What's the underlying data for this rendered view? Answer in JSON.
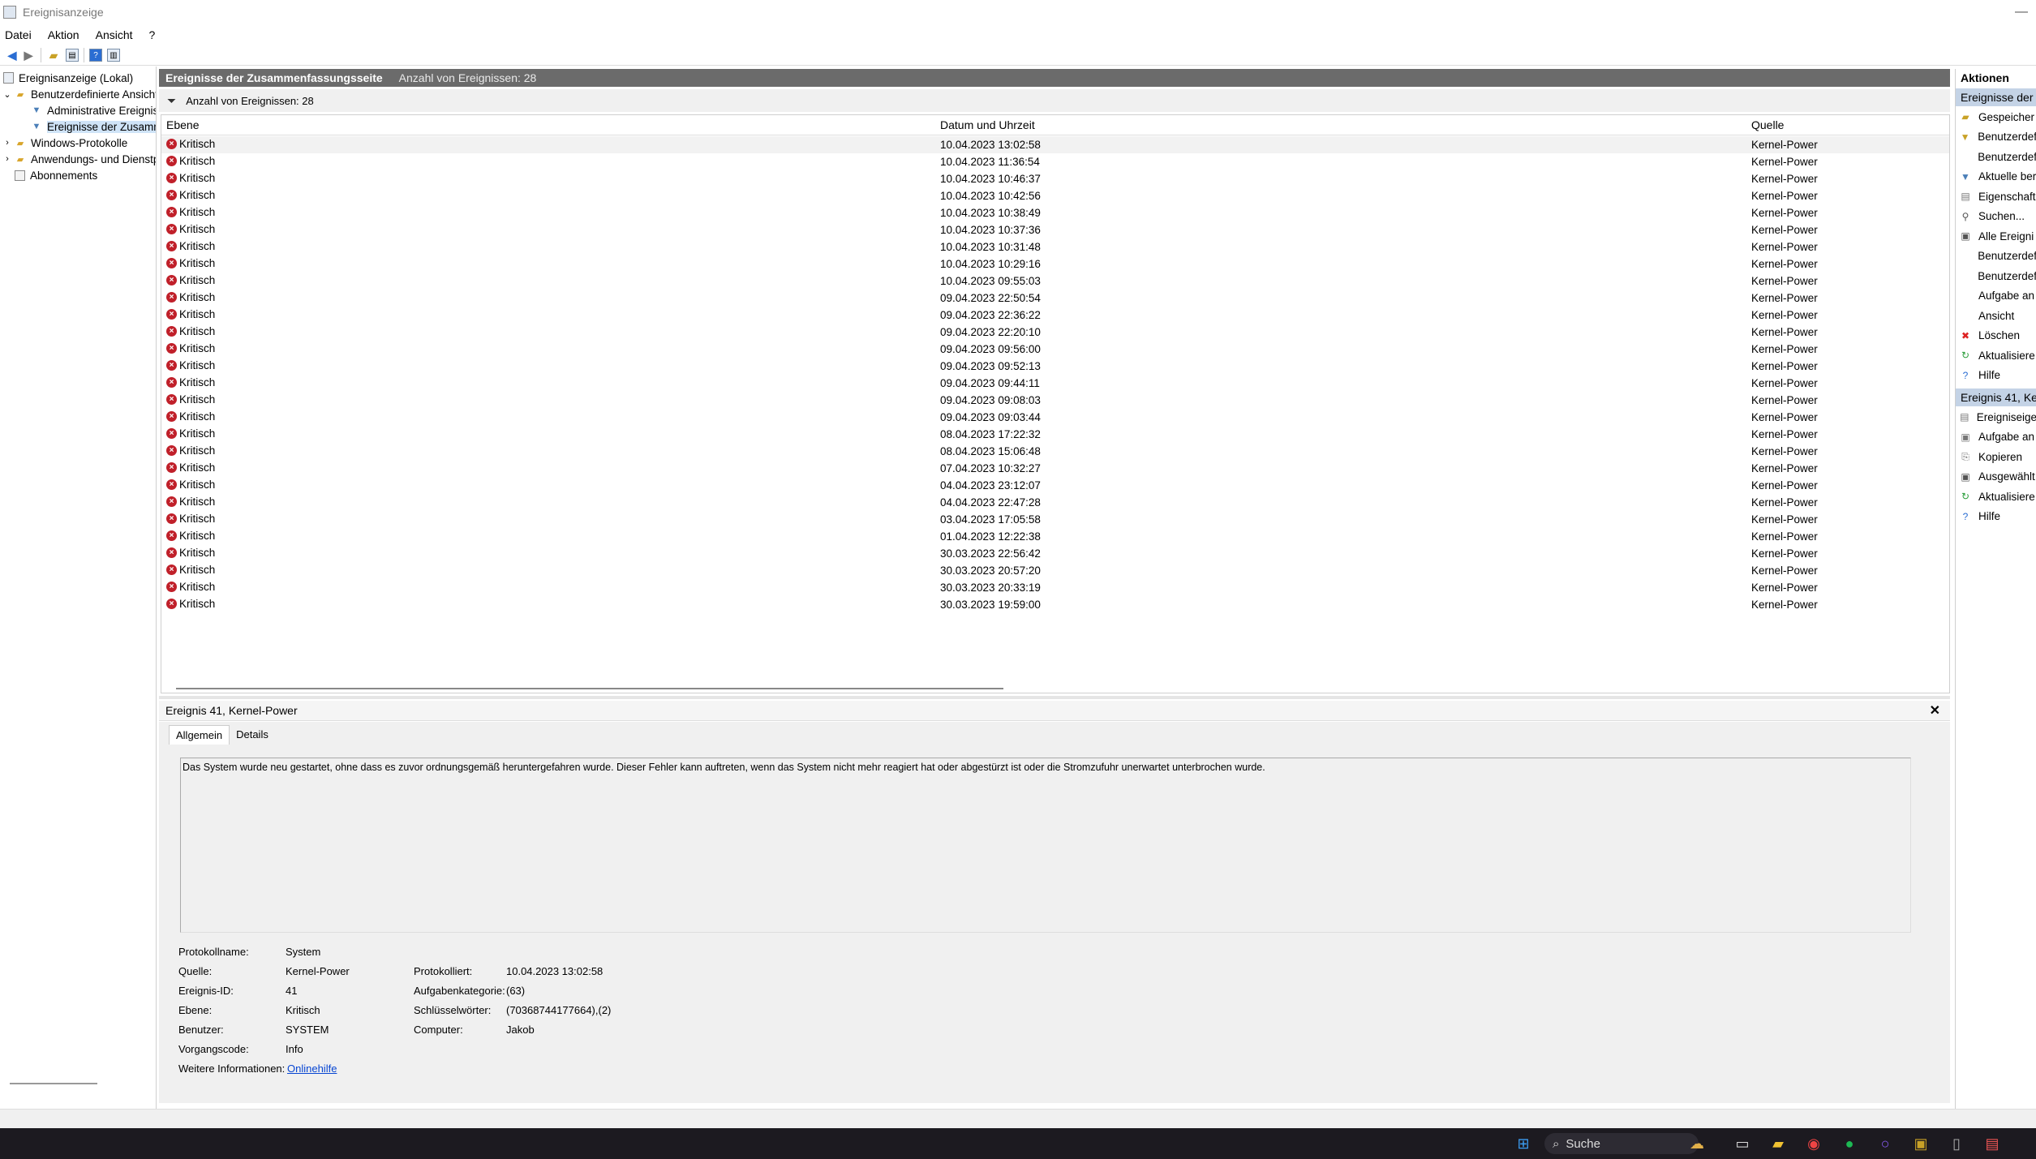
{
  "window": {
    "title": "Ereignisanzeige",
    "minimize_glyph": "—"
  },
  "menu": [
    "Datei",
    "Aktion",
    "Ansicht",
    "?"
  ],
  "toolbar_icons": [
    "back-arrow-icon",
    "forward-arrow-icon",
    "folder-up-icon",
    "console-tree-icon",
    "help-icon",
    "show-hide-action-pane-icon"
  ],
  "tree": {
    "root": "Ereignisanzeige (Lokal)",
    "custom_views": "Benutzerdefinierte Ansichten",
    "admin_events": "Administrative Ereignisse",
    "summary_events": "Ereignisse der Zusammenfassungsseite",
    "windows_logs": "Windows-Protokolle",
    "app_service_logs": "Anwendungs- und Dienstprotokolle",
    "subscriptions": "Abonnements"
  },
  "main": {
    "header_title": "Ereignisse der Zusammenfassungsseite",
    "header_count": "Anzahl von Ereignissen: 28",
    "filter_text": "Anzahl von Ereignissen: 28",
    "columns": [
      "Ebene",
      "Datum und Uhrzeit",
      "Quelle"
    ],
    "rows": [
      {
        "level": "Kritisch",
        "datetime": "10.04.2023 13:02:58",
        "source": "Kernel-Power"
      },
      {
        "level": "Kritisch",
        "datetime": "10.04.2023 11:36:54",
        "source": "Kernel-Power"
      },
      {
        "level": "Kritisch",
        "datetime": "10.04.2023 10:46:37",
        "source": "Kernel-Power"
      },
      {
        "level": "Kritisch",
        "datetime": "10.04.2023 10:42:56",
        "source": "Kernel-Power"
      },
      {
        "level": "Kritisch",
        "datetime": "10.04.2023 10:38:49",
        "source": "Kernel-Power"
      },
      {
        "level": "Kritisch",
        "datetime": "10.04.2023 10:37:36",
        "source": "Kernel-Power"
      },
      {
        "level": "Kritisch",
        "datetime": "10.04.2023 10:31:48",
        "source": "Kernel-Power"
      },
      {
        "level": "Kritisch",
        "datetime": "10.04.2023 10:29:16",
        "source": "Kernel-Power"
      },
      {
        "level": "Kritisch",
        "datetime": "10.04.2023 09:55:03",
        "source": "Kernel-Power"
      },
      {
        "level": "Kritisch",
        "datetime": "09.04.2023 22:50:54",
        "source": "Kernel-Power"
      },
      {
        "level": "Kritisch",
        "datetime": "09.04.2023 22:36:22",
        "source": "Kernel-Power"
      },
      {
        "level": "Kritisch",
        "datetime": "09.04.2023 22:20:10",
        "source": "Kernel-Power"
      },
      {
        "level": "Kritisch",
        "datetime": "09.04.2023 09:56:00",
        "source": "Kernel-Power"
      },
      {
        "level": "Kritisch",
        "datetime": "09.04.2023 09:52:13",
        "source": "Kernel-Power"
      },
      {
        "level": "Kritisch",
        "datetime": "09.04.2023 09:44:11",
        "source": "Kernel-Power"
      },
      {
        "level": "Kritisch",
        "datetime": "09.04.2023 09:08:03",
        "source": "Kernel-Power"
      },
      {
        "level": "Kritisch",
        "datetime": "09.04.2023 09:03:44",
        "source": "Kernel-Power"
      },
      {
        "level": "Kritisch",
        "datetime": "08.04.2023 17:22:32",
        "source": "Kernel-Power"
      },
      {
        "level": "Kritisch",
        "datetime": "08.04.2023 15:06:48",
        "source": "Kernel-Power"
      },
      {
        "level": "Kritisch",
        "datetime": "07.04.2023 10:32:27",
        "source": "Kernel-Power"
      },
      {
        "level": "Kritisch",
        "datetime": "04.04.2023 23:12:07",
        "source": "Kernel-Power"
      },
      {
        "level": "Kritisch",
        "datetime": "04.04.2023 22:47:28",
        "source": "Kernel-Power"
      },
      {
        "level": "Kritisch",
        "datetime": "03.04.2023 17:05:58",
        "source": "Kernel-Power"
      },
      {
        "level": "Kritisch",
        "datetime": "01.04.2023 12:22:38",
        "source": "Kernel-Power"
      },
      {
        "level": "Kritisch",
        "datetime": "30.03.2023 22:56:42",
        "source": "Kernel-Power"
      },
      {
        "level": "Kritisch",
        "datetime": "30.03.2023 20:57:20",
        "source": "Kernel-Power"
      },
      {
        "level": "Kritisch",
        "datetime": "30.03.2023 20:33:19",
        "source": "Kernel-Power"
      },
      {
        "level": "Kritisch",
        "datetime": "30.03.2023 19:59:00",
        "source": "Kernel-Power"
      }
    ]
  },
  "detail": {
    "title": "Ereignis 41, Kernel-Power",
    "tabs": [
      "Allgemein",
      "Details"
    ],
    "description": "Das System wurde neu gestartet, ohne dass es zuvor ordnungsgemäß heruntergefahren wurde. Dieser Fehler kann auftreten, wenn das System nicht mehr reagiert hat oder abgestürzt ist oder die Stromzufuhr unerwartet unterbrochen wurde.",
    "props_left": [
      {
        "label": "Protokollname:",
        "value": "System"
      },
      {
        "label": "Quelle:",
        "value": "Kernel-Power"
      },
      {
        "label": "Ereignis-ID:",
        "value": "41"
      },
      {
        "label": "Ebene:",
        "value": "Kritisch"
      },
      {
        "label": "Benutzer:",
        "value": "SYSTEM"
      },
      {
        "label": "Vorgangscode:",
        "value": "Info"
      },
      {
        "label": "Weitere Informationen:",
        "value": "Onlinehilfe"
      }
    ],
    "props_right": [
      {
        "label": "Protokolliert:",
        "value": "10.04.2023 13:02:58"
      },
      {
        "label": "Aufgabenkategorie:",
        "value": "(63)"
      },
      {
        "label": "Schlüsselwörter:",
        "value": "(70368744177664),(2)"
      },
      {
        "label": "Computer:",
        "value": "Jakob"
      }
    ]
  },
  "actions": {
    "header": "Aktionen",
    "section1": "Ereignisse der Z",
    "items1": [
      "Gespeicher",
      "Benutzerdef",
      "Benutzerdef",
      "Aktuelle ber",
      "Eigenschaft",
      "Suchen...",
      "Alle Ereigni",
      "Benutzerdef",
      "Benutzerdef",
      "Aufgabe an",
      "Ansicht",
      "Löschen",
      "Aktualisiere",
      "Hilfe"
    ],
    "section2": "Ereignis 41, Ker",
    "items2": [
      "Ereigniseige",
      "Aufgabe an",
      "Kopieren",
      "Ausgewählt",
      "Aktualisiere",
      "Hilfe"
    ]
  },
  "taskbar": {
    "search_label": "Suche"
  }
}
